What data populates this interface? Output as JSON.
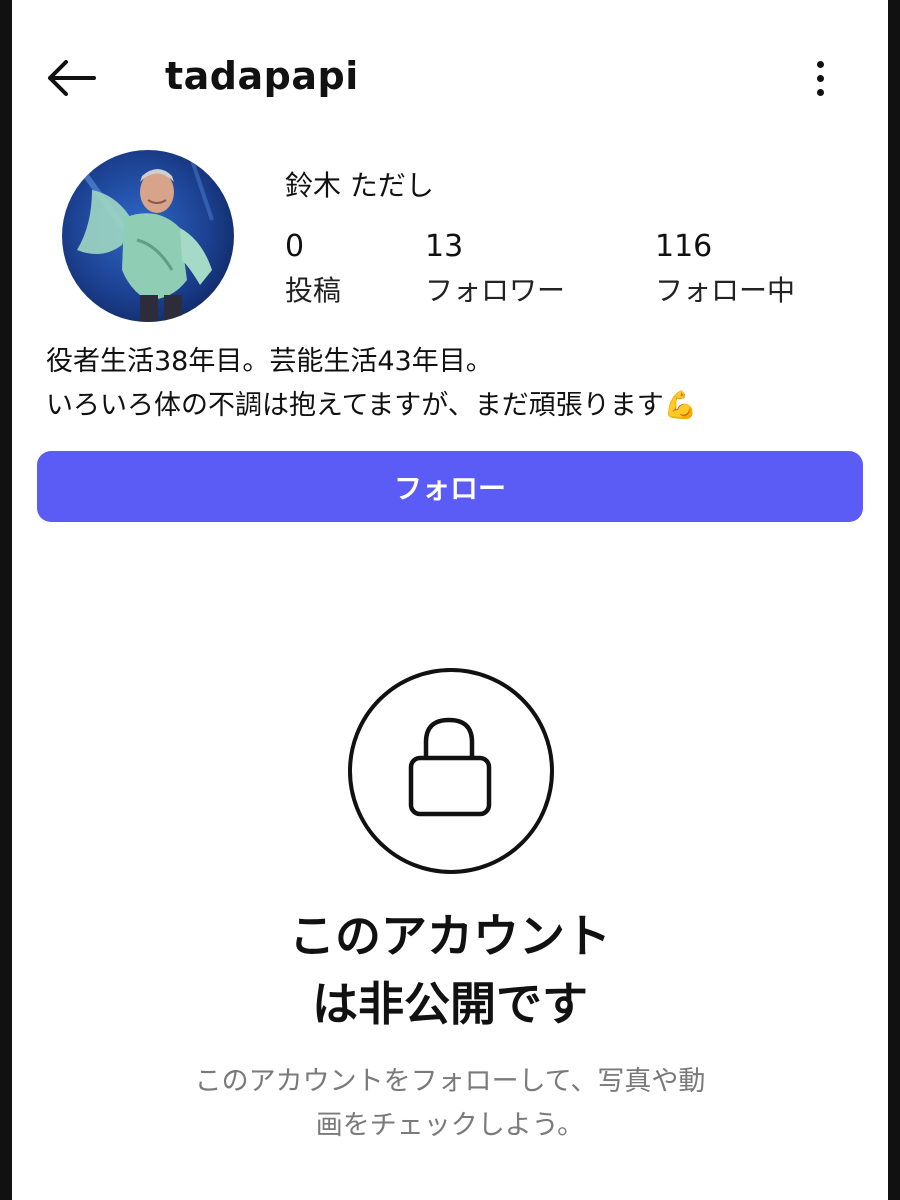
{
  "header": {
    "username": "tadapapi",
    "back_icon": "arrow-left-icon",
    "more_icon": "more-vertical-icon"
  },
  "profile": {
    "display_name": "鈴木 ただし",
    "stats": {
      "posts": {
        "value": "0",
        "label": "投稿"
      },
      "followers": {
        "value": "13",
        "label": "フォロワー"
      },
      "following": {
        "value": "116",
        "label": "フォロー中"
      }
    },
    "bio": {
      "line1": "役者生活38年目。芸能生活43年目。",
      "line2": "いろいろ体の不調は抱えてますが、まだ頑張ります",
      "emoji": "💪"
    }
  },
  "follow_button": {
    "label": "フォロー",
    "color": "#5b5cf6"
  },
  "private_notice": {
    "icon": "lock-icon",
    "title_line1": "このアカウント",
    "title_line2": "は非公開です",
    "subtitle_line1": "このアカウントをフォローして、写真や動",
    "subtitle_line2": "画をチェックしよう。"
  }
}
